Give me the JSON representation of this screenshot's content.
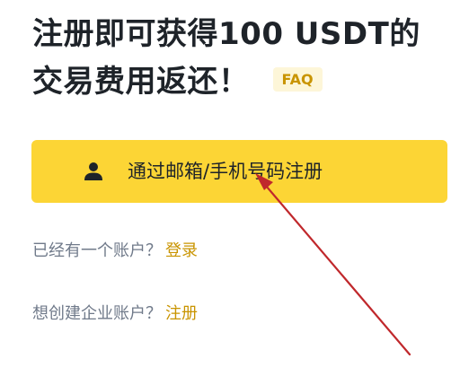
{
  "headline": {
    "title": "注册即可获得100 USDT的交易费用返还！",
    "faq_label": "FAQ"
  },
  "register_button": {
    "label": "通过邮箱/手机号码注册",
    "icon": "user-icon"
  },
  "login_row": {
    "prompt": "已经有一个账户？",
    "link": "登录"
  },
  "enterprise_row": {
    "prompt": "想创建企业账户？",
    "link": "注册"
  },
  "colors": {
    "primary_yellow": "#fcd535",
    "link_gold": "#c99400",
    "text_dark": "#1e2329",
    "text_gray": "#707a8a",
    "annotation_arrow": "#c0282c"
  }
}
